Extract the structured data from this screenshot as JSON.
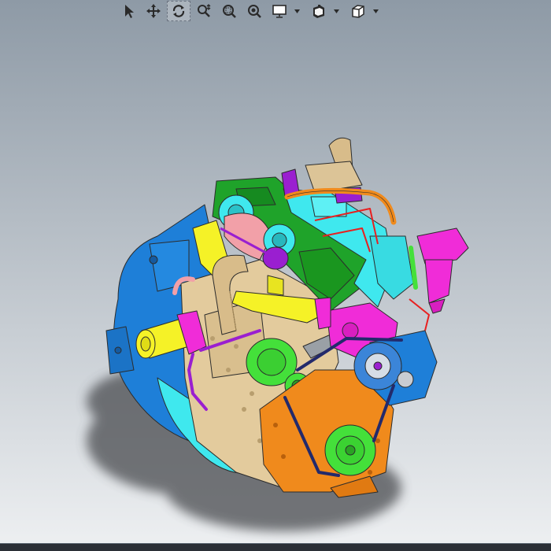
{
  "colors": {
    "bg_top": "#8e9aa6",
    "bg_bottom": "#eef0f2",
    "block": "#e3cb9d",
    "orange": "#f08a1c",
    "green": "#1fa32a",
    "lime": "#44e03a",
    "magenta": "#f02cd8",
    "cyan": "#3fe8ee",
    "blue": "#1e7fd8",
    "yellow": "#f5f227",
    "purple": "#9a1fd0",
    "pink": "#f2a0a8",
    "navy": "#232a6b"
  },
  "toolbar": {
    "tools": [
      {
        "id": "select",
        "icon": "select-arrow-icon",
        "active": false
      },
      {
        "id": "pan",
        "icon": "pan-arrows-icon",
        "active": false
      },
      {
        "id": "rotate",
        "icon": "rotate-icon",
        "active": true
      },
      {
        "id": "zoom-fit",
        "icon": "zoom-in-out-icon",
        "active": false
      },
      {
        "id": "zoom-area",
        "icon": "zoom-area-icon",
        "active": false
      },
      {
        "id": "zoom-selection",
        "icon": "zoom-selection-icon",
        "active": false
      },
      {
        "id": "display-style",
        "icon": "monitor-icon",
        "active": false,
        "dropdown": true
      },
      {
        "id": "view-settings",
        "icon": "view-settings-icon",
        "active": false,
        "dropdown": true
      },
      {
        "id": "view-orientation",
        "icon": "cube-view-icon",
        "active": false,
        "dropdown": true
      }
    ]
  }
}
